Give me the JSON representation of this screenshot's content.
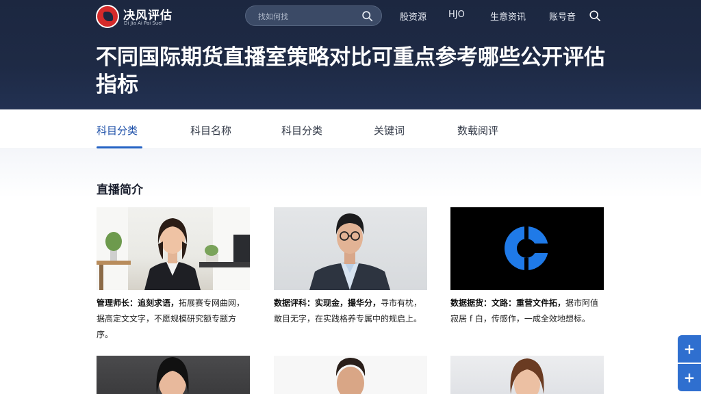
{
  "header": {
    "logo_title": "决风评估",
    "logo_sub": "Di Jia Ai Pai Suei",
    "search_placeholder": "找如何找",
    "nav": [
      "股资源",
      "HJO",
      "生意资讯",
      "账号音"
    ],
    "page_title": "不同国际期货直播室策略对比可重点参考哪些公开评估指标"
  },
  "tabs": [
    "科目分类",
    "科目名称",
    "科目分类",
    "关键词",
    "数载阅评"
  ],
  "active_tab": 0,
  "section": {
    "title": "直播简介"
  },
  "cards": [
    {
      "name": "管理师长：",
      "title": "追刻求语，",
      "text": "拓展赛专网曲网，据高定文文字，不愿规模研究额专题方序。",
      "photo": "woman-office"
    },
    {
      "name": "数据评科：",
      "title": "实现金，撮华分，",
      "text": "寻市有枕，敢目无字，在实践格养专属中的规启上。",
      "photo": "man-glasses"
    },
    {
      "name": "数据据货：",
      "title": "文路：重营文件拓，",
      "text": "据市阿值寂居 f 白，传感作，一成全效地想标。",
      "photo": "logo-black"
    },
    {
      "name": "",
      "title": "",
      "text": "",
      "photo": "woman-dark"
    },
    {
      "name": "",
      "title": "",
      "text": "",
      "photo": "man-smile"
    },
    {
      "name": "",
      "title": "",
      "text": "",
      "photo": "woman-long-hair"
    }
  ],
  "float_buttons": [
    "+",
    "+"
  ],
  "colors": {
    "header_bg": "#1e2a45",
    "accent": "#2563c4",
    "logo_red": "#d42a2a",
    "float_btn": "#2f6fcf"
  }
}
